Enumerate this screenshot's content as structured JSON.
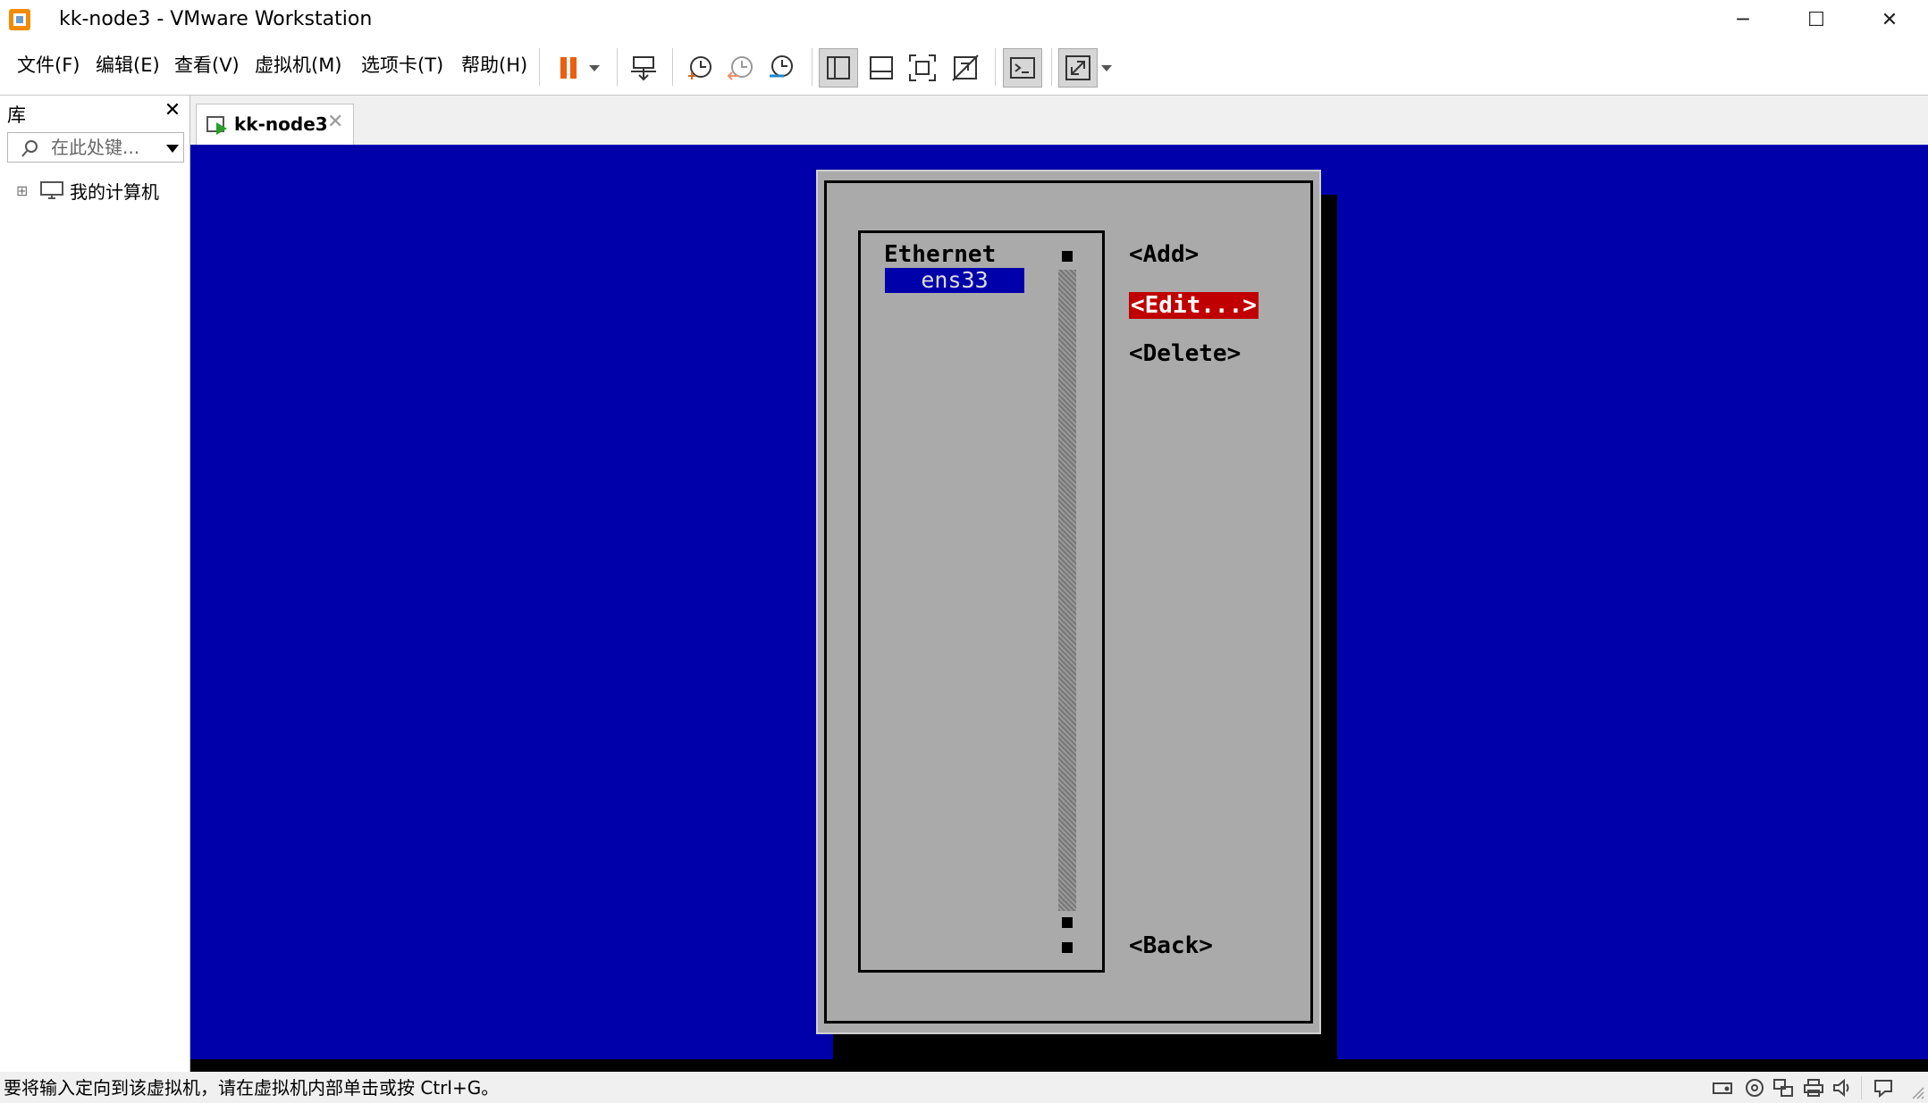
{
  "window": {
    "title": "kk-node3 - VMware Workstation",
    "minimize": "─",
    "maximize": "☐",
    "close": "✕"
  },
  "menu": [
    "文件(F)",
    "编辑(E)",
    "查看(V)",
    "虚拟机(M)",
    "选项卡(T)",
    "帮助(H)"
  ],
  "toolbar": {
    "pause_color": "#e86010",
    "icons": [
      "pause-icon",
      "dropdown-arrow-icon",
      "send-ctrl-alt-del-icon",
      "snapshot-take-icon",
      "snapshot-revert-icon",
      "snapshot-manager-icon",
      "library-view-icon",
      "thumbnail-bar-icon",
      "fullscreen-icon",
      "unity-icon",
      "console-view-icon",
      "stretch-icon"
    ]
  },
  "library": {
    "title": "库",
    "close": "✕",
    "search_placeholder": "在此处键...",
    "tree_root": "我的计算机",
    "expander": "⊞"
  },
  "tab": {
    "label": "kk-node3",
    "close": "✕"
  },
  "console": {
    "background": "#0000aa",
    "list": {
      "header": "Ethernet",
      "items": [
        "ens33"
      ],
      "selected": "ens33"
    },
    "buttons": {
      "add": "<Add>",
      "edit": "<Edit...>",
      "delete": "<Delete>",
      "back": "<Back>"
    },
    "focused_button": "edit",
    "focus_color": "#c00000"
  },
  "status": {
    "hint": "要将输入定向到该虚拟机，请在虚拟机内部单击或按 Ctrl+G。",
    "icons": [
      "hard-disk-icon",
      "cd-drive-icon",
      "network-adapter-icon",
      "printer-icon",
      "sound-icon",
      "message-icon"
    ]
  }
}
